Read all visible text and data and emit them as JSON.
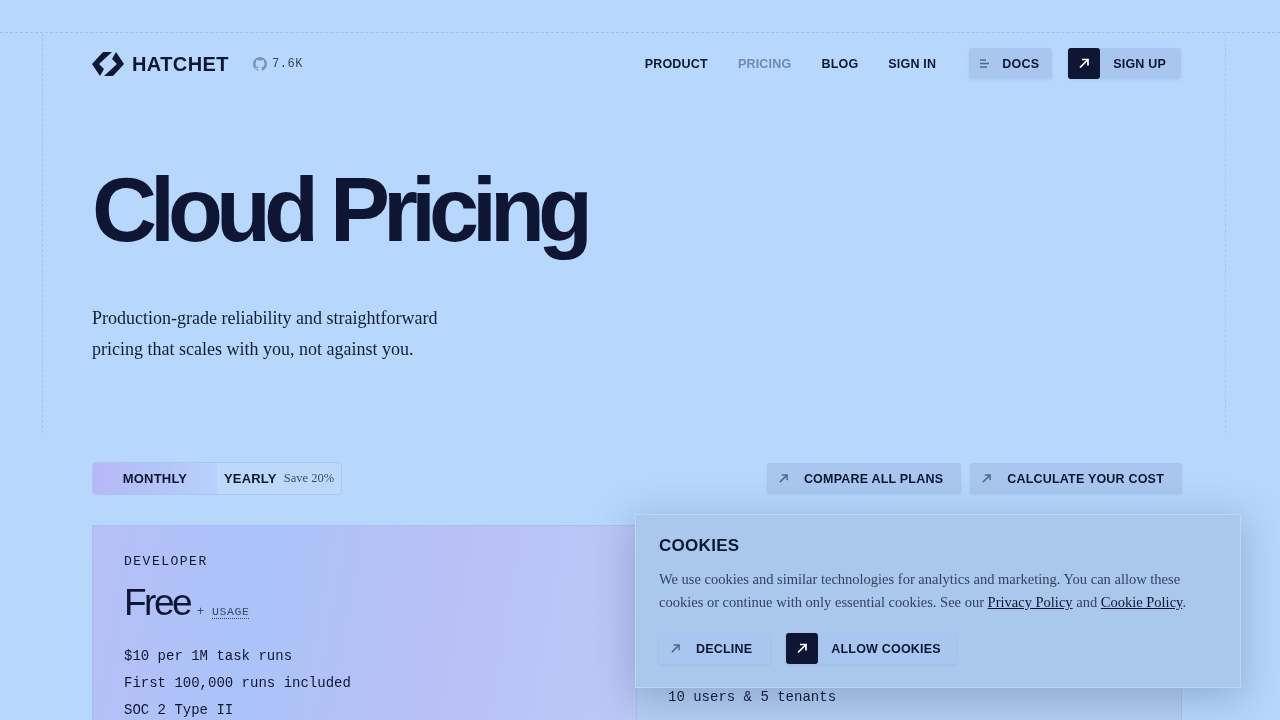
{
  "header": {
    "logo": "HATCHET",
    "github_stars": "7.6K",
    "nav": [
      {
        "label": "PRODUCT",
        "selected": false
      },
      {
        "label": "PRICING",
        "selected": true
      },
      {
        "label": "BLOG",
        "selected": false
      },
      {
        "label": "SIGN IN",
        "selected": false
      }
    ],
    "buttons": [
      {
        "label": "DOCS",
        "kind": "menu"
      },
      {
        "label": "SIGN UP",
        "kind": "primary"
      }
    ]
  },
  "hero": {
    "title": "Cloud Pricing",
    "subtitle": "Production-grade reliability and straightforward pricing that scales with you, not against you."
  },
  "billing_toggle": {
    "options": [
      {
        "label": "MONTHLY",
        "selected": true
      },
      {
        "label": "YEARLY",
        "note": "Save 20%",
        "selected": false
      }
    ]
  },
  "actions": [
    {
      "label": "COMPARE ALL PLANS",
      "kind": "plain"
    },
    {
      "label": "CALCULATE YOUR COST",
      "kind": "plain"
    }
  ],
  "plans": [
    {
      "name": "DEVELOPER",
      "price": "Free",
      "price_plus": "+",
      "price_unit": "USAGE",
      "features": [
        "$10 per 1M task runs",
        "First 100,000 runs included",
        "SOC 2 Type II"
      ]
    },
    {
      "features": [
        "10 users & 5 tenants"
      ]
    }
  ],
  "cookie_banner": {
    "title": "COOKIES",
    "text": [
      {
        "kind": "text",
        "text": "We use cookies and similar technologies for analytics and marketing. You can allow these cookies or continue with only essential cookies. See our "
      },
      {
        "kind": "link",
        "text": "Privacy Policy"
      },
      {
        "kind": "text",
        "text": " and "
      },
      {
        "kind": "link",
        "text": "Cookie Policy"
      },
      {
        "kind": "text",
        "text": "."
      }
    ],
    "buttons": [
      {
        "label": "DECLINE",
        "kind": "plain"
      },
      {
        "label": "ALLOW COOKIES",
        "kind": "primary"
      }
    ]
  }
}
